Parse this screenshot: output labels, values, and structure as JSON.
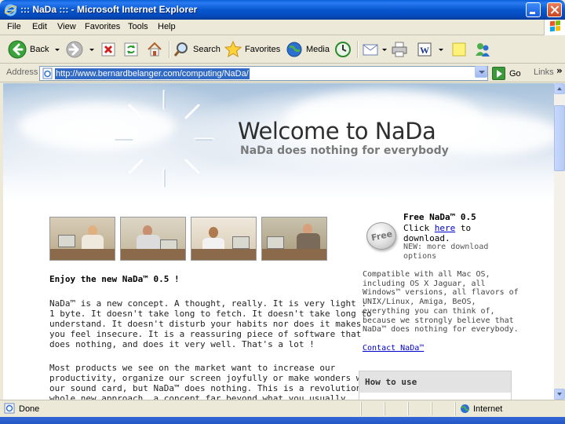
{
  "window": {
    "title": "::: NaDa ::: - Microsoft Internet Explorer"
  },
  "menu": {
    "items": [
      "File",
      "Edit",
      "View",
      "Favorites",
      "Tools",
      "Help"
    ]
  },
  "toolbar": {
    "back_label": "Back",
    "search_label": "Search",
    "favorites_label": "Favorites",
    "media_label": "Media"
  },
  "address": {
    "label": "Address",
    "url": "http://www.bernardbelanger.com/computing/NaDa/",
    "go_label": "Go",
    "links_label": "Links",
    "links_chevron": "»"
  },
  "page": {
    "welcome": "Welcome to NaDa",
    "tagline": "NaDa does nothing for everybody",
    "enjoy": "Enjoy the new NaDa™ 0.5 !",
    "para1_lines": [
      "NaDa™ is a new concept. A thought, really. It is very light :",
      "1 byte. It doesn't take long to fetch. It doesn't take long to",
      "understand. It doesn't disturb your habits nor does it makes",
      "you feel insecure. It is a reassuring piece of software that",
      "does nothing, and does it very well. That's a lot !"
    ],
    "para2_lines": [
      "Most products we see on the market want to increase our",
      "productivity, organize our screen joyfully or make wonders with",
      "our sound card, but NaDa™ does nothing. This is a revolutionary",
      "whole new approach, a concept far beyond what you usually"
    ],
    "free_badge": "Free",
    "free_title": "Free NaDa™ 0.5",
    "click_prefix": "Click ",
    "here_link": "here",
    "click_suffix": " to",
    "download_line": "download.",
    "new_options_lines": [
      "NEW: more download",
      "options"
    ],
    "compat_lines": [
      "Compatible with all Mac OS,",
      "including OS X Jaguar, all",
      "Windows™ versions, all flavors of",
      "UNIX/Linux, Amiga, BeOS,",
      "everything you can think of,",
      "because we strongly believe that",
      "NaDa™ does nothing for everybody."
    ],
    "contact": "Contact NaDa™",
    "how_to_use": "How to use"
  },
  "status": {
    "text": "Done",
    "zone": "Internet"
  },
  "colors": {
    "titlebar": "#0757d0",
    "link": "#0000cc",
    "url_highlight": "#316ac5"
  }
}
